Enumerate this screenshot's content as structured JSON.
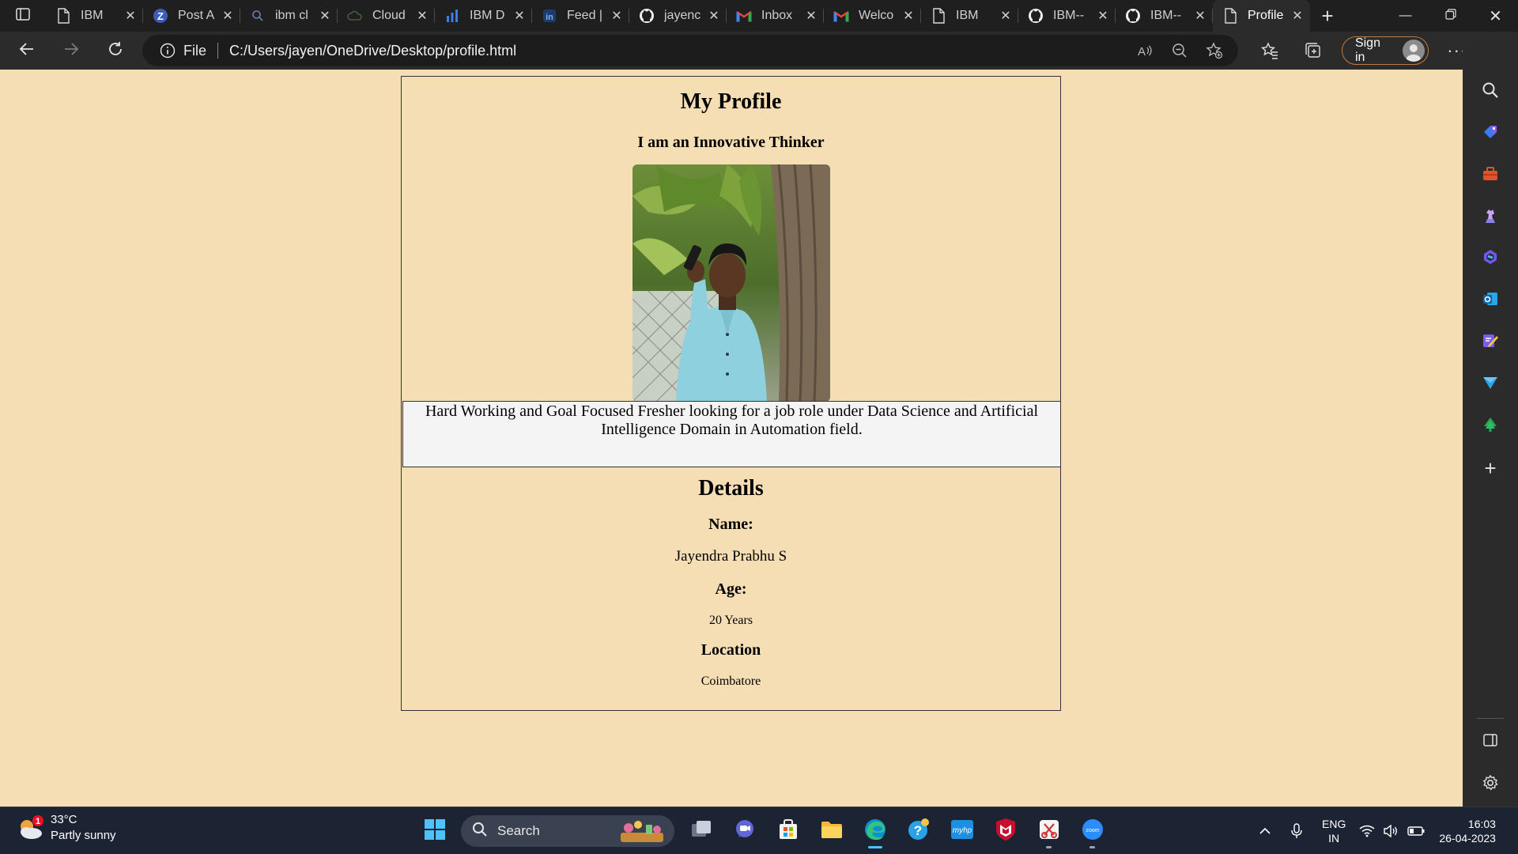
{
  "browser": {
    "tabs": [
      {
        "title": "IBM",
        "icon": "page-icon"
      },
      {
        "title": "Post A",
        "icon": "zoho-icon"
      },
      {
        "title": "ibm cl",
        "icon": "search-icon"
      },
      {
        "title": "Cloud",
        "icon": "cloud-icon"
      },
      {
        "title": "IBM D",
        "icon": "chart-icon"
      },
      {
        "title": "Feed |",
        "icon": "linkedin-icon"
      },
      {
        "title": "jayenc",
        "icon": "github-icon"
      },
      {
        "title": "Inbox",
        "icon": "gmail-icon"
      },
      {
        "title": "Welco",
        "icon": "gmail-icon"
      },
      {
        "title": "IBM",
        "icon": "page-icon"
      },
      {
        "title": "IBM--",
        "icon": "github-icon"
      },
      {
        "title": "IBM--",
        "icon": "github-icon"
      },
      {
        "title": "Profile",
        "icon": "page-icon",
        "active": true
      }
    ],
    "address": {
      "scheme": "File",
      "url": "C:/Users/jayen/OneDrive/Desktop/profile.html"
    },
    "sign_in_label": "Sign in"
  },
  "page": {
    "title": "My Profile",
    "tagline": "I am an Innovative Thinker",
    "bio": "Hard Working and Goal Focused Fresher looking for a job role under Data Science and Artificial Intelligence Domain in Automation field.",
    "details_heading": "Details",
    "name_label": "Name:",
    "name_value": "Jayendra Prabhu S",
    "age_label": "Age:",
    "age_value": "20 Years",
    "location_label": "Location",
    "location_value": "Coimbatore"
  },
  "taskbar": {
    "weather": {
      "temp": "33°C",
      "condition": "Partly sunny",
      "alert_count": "1"
    },
    "search_label": "Search",
    "lang": {
      "line1": "ENG",
      "line2": "IN"
    },
    "clock": {
      "time": "16:03",
      "date": "26-04-2023"
    }
  },
  "colors": {
    "page_background": "#f5deb3",
    "bio_background": "#f4f4f4",
    "sign_in_border": "#c27c3b",
    "active_indicator": "#4cc2ff"
  }
}
